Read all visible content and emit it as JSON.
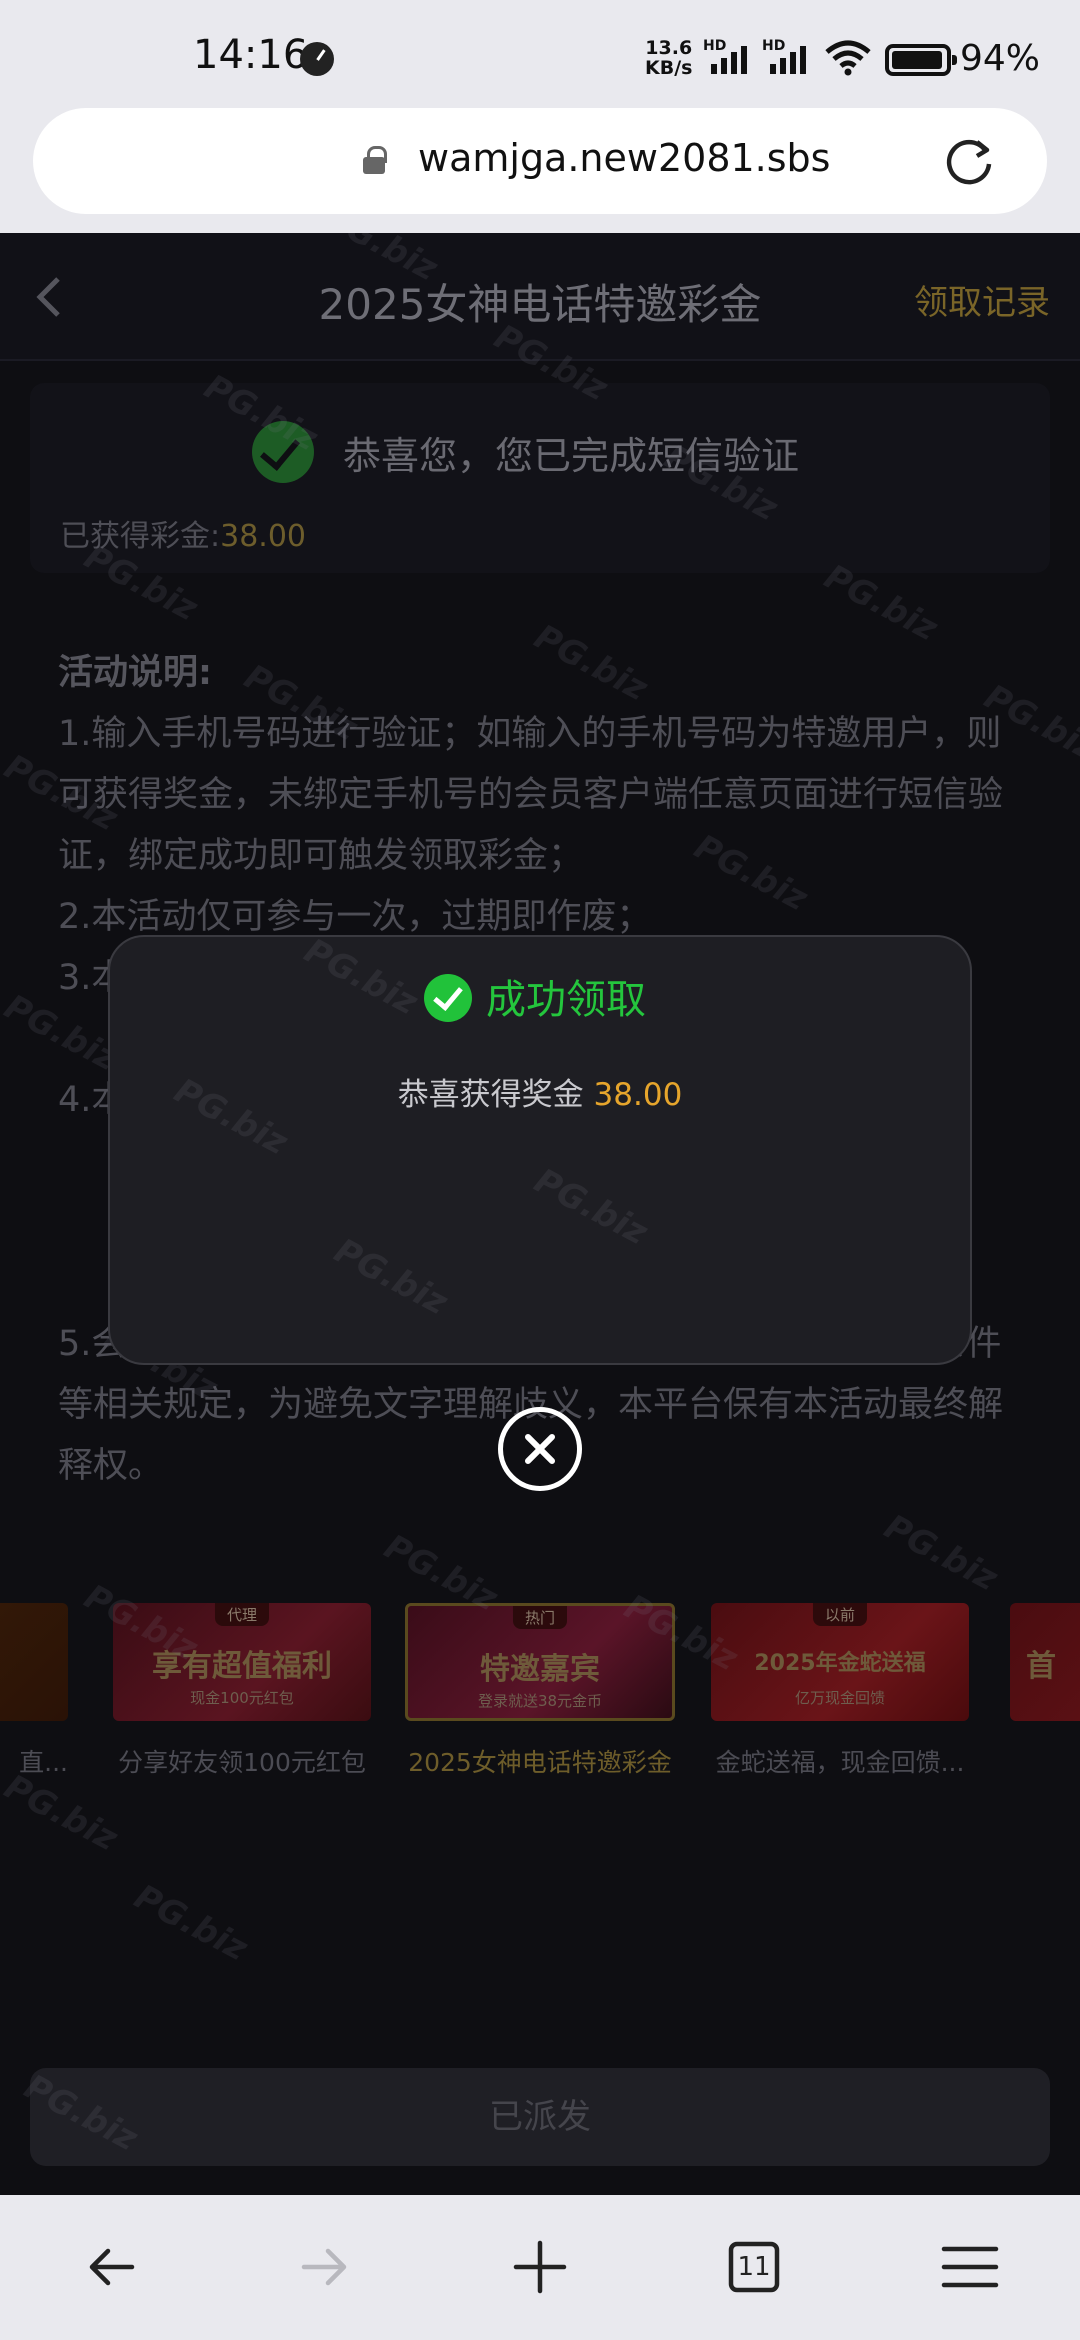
{
  "status_bar": {
    "time": "14:16",
    "net_speed_value": "13.6",
    "net_speed_unit": "KB/s",
    "sim1_label": "HD",
    "sim2_label": "HD",
    "battery": "94%"
  },
  "browser": {
    "url": "wamjga.new2081.sbs",
    "tabs_count": "11"
  },
  "header": {
    "title": "2025女神电话特邀彩金",
    "record_link": "领取记录"
  },
  "verify": {
    "message": "恭喜您，您已完成短信验证",
    "earned_label": "已获得彩金:",
    "earned_amount": "38.00"
  },
  "rules": {
    "title": "活动说明:",
    "items": [
      "1.输入手机号码进行验证；如输入的手机号码为特邀用户，则可获得奖金，未绑定手机号的会员客户端任意页面进行短信验证，绑定成功即可触发领取彩金；",
      "2.本活动仅可参与一次，过期即作废；",
      "3.本",
      "4.本",
      "5.会员参与该活动时，本平台将默认会员同意且遵守对应条件等相关规定，为避免文字理解歧义，本平台保有本活动最终解释权。"
    ]
  },
  "promos": [
    {
      "caption": "直...",
      "tag": "",
      "big": "",
      "sub": ""
    },
    {
      "caption": "分享好友领100元红包",
      "tag": "代理",
      "big": "享有超值福利",
      "sub": "现金100元红包"
    },
    {
      "caption": "2025女神电话特邀彩金",
      "tag": "热门",
      "big": "特邀嘉宾",
      "sub": "登录就送38元金币"
    },
    {
      "caption": "金蛇送福，现金回馈...",
      "tag": "以前",
      "big": "2025年金蛇送福",
      "sub": "亿万现金回馈"
    },
    {
      "caption": "",
      "tag": "",
      "big": "首",
      "sub": ""
    }
  ],
  "bottom_button": "已派发",
  "modal": {
    "title": "成功领取",
    "reward_label": "恭喜获得奖金",
    "reward_amount": "38.00"
  },
  "watermark": "PG.biz",
  "colors": {
    "success_green": "#21c23a",
    "gold": "#e6a52c",
    "page_bg": "#0e0e12",
    "modal_bg": "#1e1e23"
  }
}
